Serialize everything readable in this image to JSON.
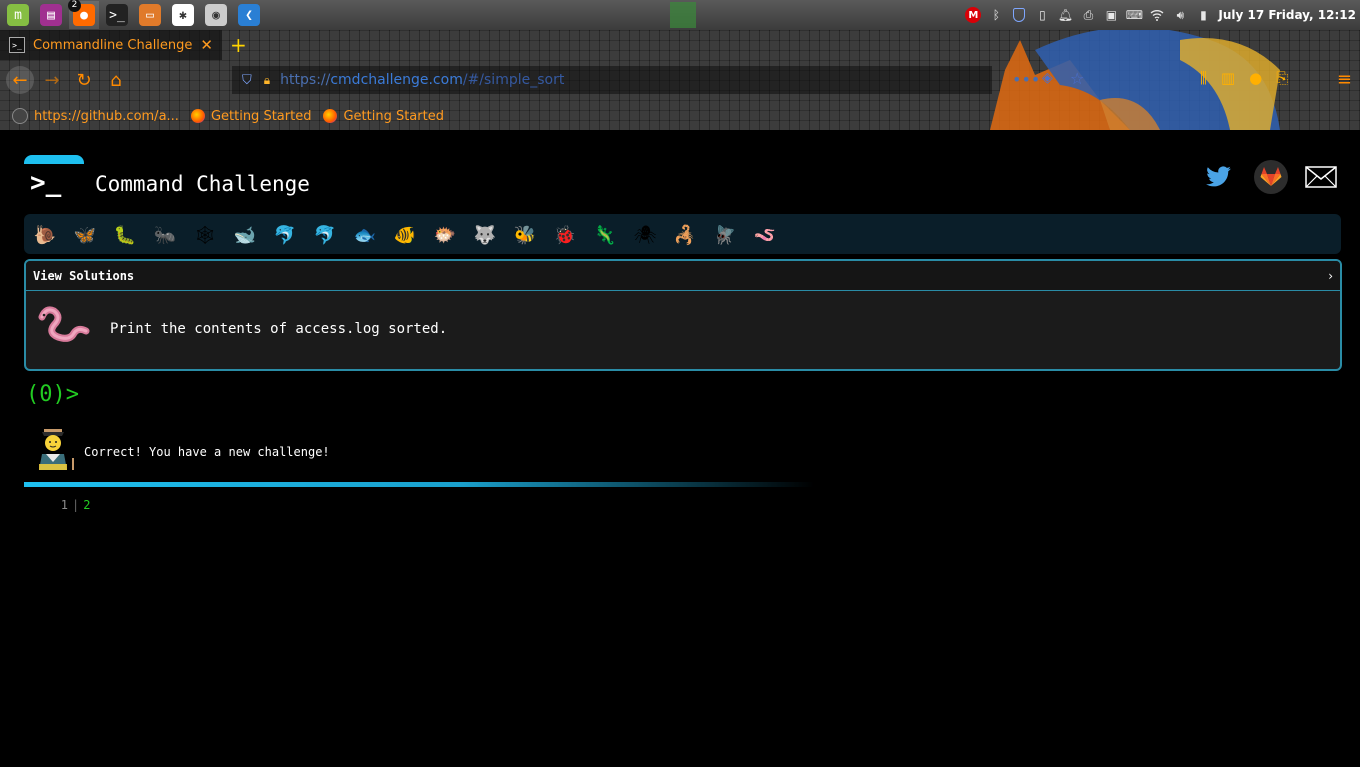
{
  "taskbar": {
    "apps": [
      {
        "name": "mint-menu-icon",
        "color": "#86be43",
        "glyph": "m"
      },
      {
        "name": "video-app-icon",
        "color": "#a03090",
        "glyph": "▤"
      },
      {
        "name": "firefox-icon",
        "color": "#ff6a00",
        "glyph": "●",
        "badge": "2"
      },
      {
        "name": "terminal-icon",
        "color": "#222222",
        "glyph": ">_"
      },
      {
        "name": "files-icon",
        "color": "#e07a2a",
        "glyph": "▭"
      },
      {
        "name": "slack-icon",
        "color": "#ffffff",
        "glyph": "✱"
      },
      {
        "name": "screenshot-icon",
        "color": "#cccccc",
        "glyph": "◉"
      },
      {
        "name": "vscode-icon",
        "color": "#2a7fd4",
        "glyph": "❮"
      }
    ],
    "clock": "July 17 Friday, 12:12"
  },
  "browser": {
    "tab_title": "Commandline Challenge",
    "tab_favicon": ">_",
    "url_scheme": "https://",
    "url_host": "cmdchallenge.com",
    "url_path": "/#/simple_sort",
    "bookmarks": [
      {
        "label": "https://github.com/a...",
        "icon": "github-icon"
      },
      {
        "label": "Getting Started",
        "icon": "firefox-icon"
      },
      {
        "label": "Getting Started",
        "icon": "firefox-icon"
      }
    ]
  },
  "page": {
    "site_title": "Command Challenge",
    "logo_text": ">_",
    "solutions_label": "View Solutions",
    "solutions_chevron": "›",
    "task": "Print the contents of access.log sorted.",
    "prompt": "(0)>",
    "feedback": "Correct! You have a new challenge!",
    "output_line_number": "1",
    "output_value": "2",
    "challenge_progress": 0.6,
    "animals": [
      {
        "name": "snail-icon",
        "glyph": "🐌"
      },
      {
        "name": "butterfly-icon",
        "glyph": "🦋"
      },
      {
        "name": "caterpillar-icon",
        "glyph": "🐛"
      },
      {
        "name": "ant-icon",
        "glyph": "🐜"
      },
      {
        "name": "spider-web-icon",
        "glyph": "🕸"
      },
      {
        "name": "whale-icon",
        "glyph": "🐋"
      },
      {
        "name": "dolphin-icon",
        "glyph": "🐬"
      },
      {
        "name": "dolphin-2-icon",
        "glyph": "🐬"
      },
      {
        "name": "fish-icon",
        "glyph": "🐟"
      },
      {
        "name": "tropical-fish-icon",
        "glyph": "🐠"
      },
      {
        "name": "blowfish-icon",
        "glyph": "🐡"
      },
      {
        "name": "wolf-icon",
        "glyph": "🐺"
      },
      {
        "name": "bee-icon",
        "glyph": "🐝"
      },
      {
        "name": "ladybug-icon",
        "glyph": "🐞"
      },
      {
        "name": "lizard-icon",
        "glyph": "🦎"
      },
      {
        "name": "spider-icon",
        "glyph": "🕷"
      },
      {
        "name": "scorpion-icon",
        "glyph": "🦂"
      },
      {
        "name": "fly-icon",
        "glyph": "🪰"
      },
      {
        "name": "worm-icon",
        "glyph": "🪱"
      }
    ]
  }
}
